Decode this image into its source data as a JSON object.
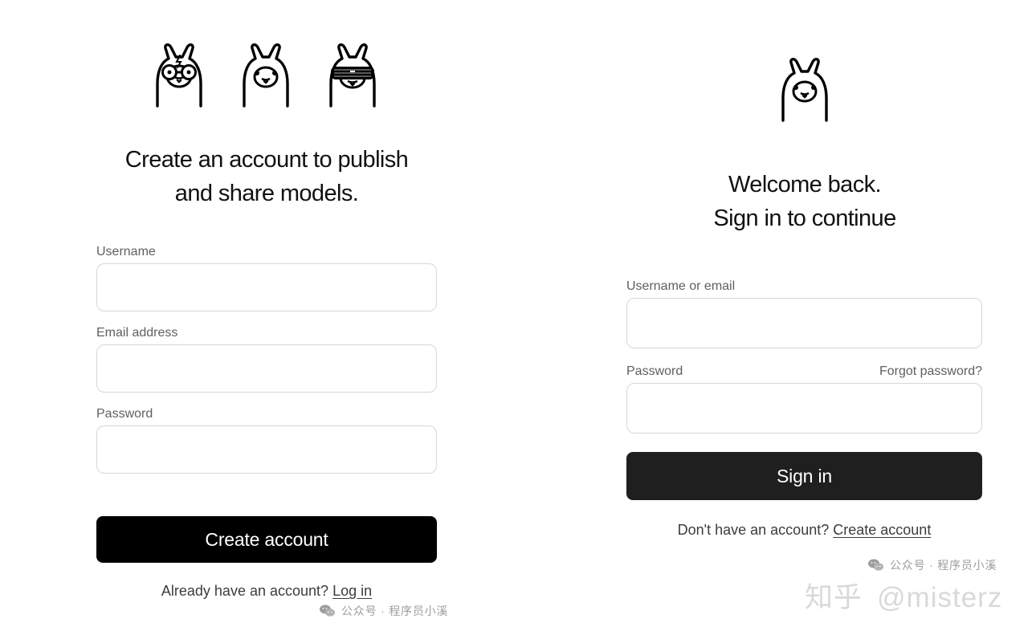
{
  "signup": {
    "mascots": [
      "llama-with-glasses-icon",
      "llama-icon",
      "llama-with-sunglasses-icon"
    ],
    "title_line1": "Create an account to publish",
    "title_line2": "and share models.",
    "username_label": "Username",
    "username_value": "",
    "email_label": "Email address",
    "email_value": "",
    "password_label": "Password",
    "password_value": "",
    "submit_label": "Create account",
    "footer_prefix": "Already have an account?",
    "footer_link": "Log in",
    "watermark": "公众号 · 程序员小溪"
  },
  "signin": {
    "mascot": "llama-icon",
    "title_line1": "Welcome back.",
    "title_line2": "Sign in to continue",
    "username_label": "Username or email",
    "username_value": "",
    "password_label": "Password",
    "password_value": "",
    "forgot_link": "Forgot password?",
    "submit_label": "Sign in",
    "footer_prefix": "Don't have an account?",
    "footer_link": "Create account",
    "watermark": "公众号 · 程序员小溪"
  },
  "overlay": {
    "brand": "知乎",
    "handle": "@misterz"
  },
  "colors": {
    "text": "#111111",
    "muted": "#5f5f5f",
    "border": "#d7d7d7",
    "signup_button": "#000000",
    "signin_button": "#1f1f1f",
    "watermark": "#9d9d9d"
  }
}
